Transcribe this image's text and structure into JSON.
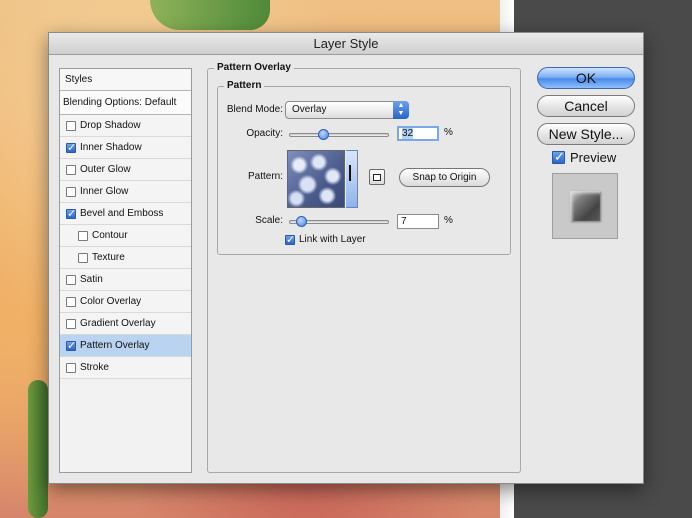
{
  "window": {
    "title": "Layer Style"
  },
  "styles_panel": {
    "header": "Styles",
    "blending_options": "Blending Options: Default",
    "items": [
      {
        "label": "Drop Shadow",
        "checked": false,
        "sub": false,
        "selected": false
      },
      {
        "label": "Inner Shadow",
        "checked": true,
        "sub": false,
        "selected": false
      },
      {
        "label": "Outer Glow",
        "checked": false,
        "sub": false,
        "selected": false
      },
      {
        "label": "Inner Glow",
        "checked": false,
        "sub": false,
        "selected": false
      },
      {
        "label": "Bevel and Emboss",
        "checked": true,
        "sub": false,
        "selected": false
      },
      {
        "label": "Contour",
        "checked": false,
        "sub": true,
        "selected": false
      },
      {
        "label": "Texture",
        "checked": false,
        "sub": true,
        "selected": false
      },
      {
        "label": "Satin",
        "checked": false,
        "sub": false,
        "selected": false
      },
      {
        "label": "Color Overlay",
        "checked": false,
        "sub": false,
        "selected": false
      },
      {
        "label": "Gradient Overlay",
        "checked": false,
        "sub": false,
        "selected": false
      },
      {
        "label": "Pattern Overlay",
        "checked": true,
        "sub": false,
        "selected": true
      },
      {
        "label": "Stroke",
        "checked": false,
        "sub": false,
        "selected": false
      }
    ]
  },
  "pattern_overlay": {
    "section_title": "Pattern Overlay",
    "group_title": "Pattern",
    "blend_mode_label": "Blend Mode:",
    "blend_mode_value": "Overlay",
    "opacity_label": "Opacity:",
    "opacity_value": "32",
    "opacity_percent": 32,
    "pattern_label": "Pattern:",
    "snap_button": "Snap to Origin",
    "scale_label": "Scale:",
    "scale_value": "7",
    "scale_percent": 7,
    "percent_sign": "%",
    "link_label": "Link with Layer",
    "link_checked": true
  },
  "buttons": {
    "ok": "OK",
    "cancel": "Cancel",
    "new_style": "New Style...",
    "preview_label": "Preview",
    "preview_checked": true
  },
  "colors": {
    "selection": "#b9d3f1",
    "primary_button": "#4a8ae8",
    "dialog_bg": "#e8e8e8"
  }
}
